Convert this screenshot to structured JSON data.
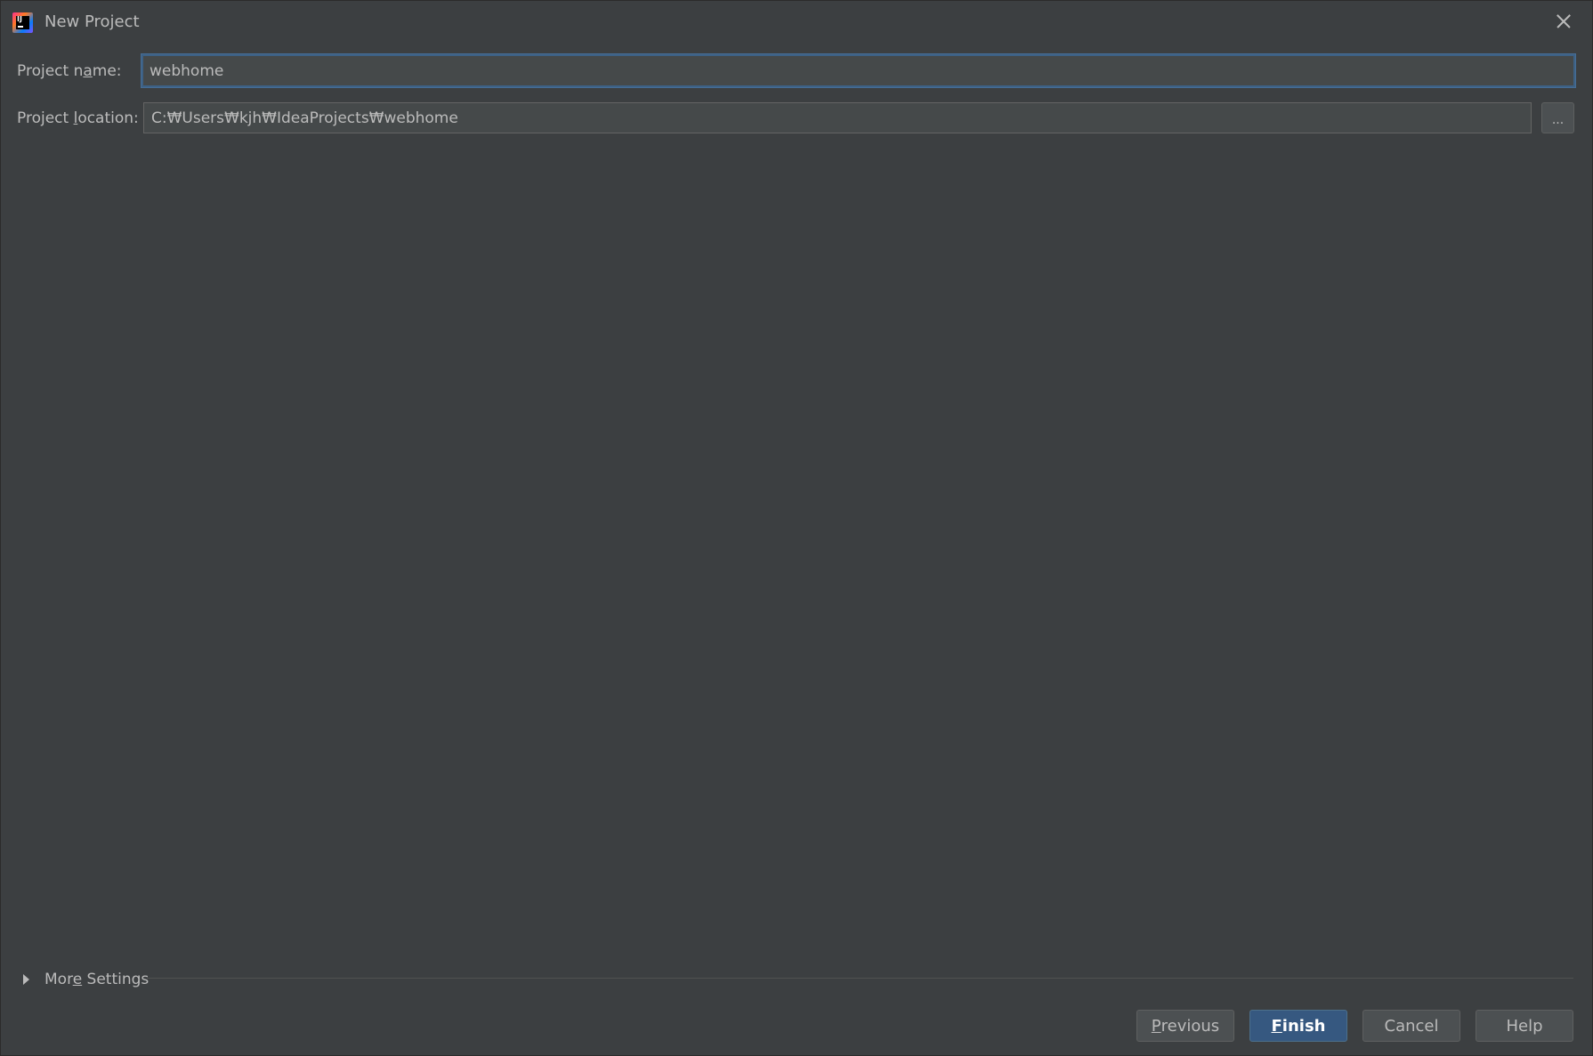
{
  "window": {
    "title": "New Project",
    "app_icon": "intellij-idea-icon",
    "close_icon": "close-icon"
  },
  "form": {
    "project_name": {
      "label_pre": "Project n",
      "label_mnemonic": "a",
      "label_post": "me:",
      "value": "webhome"
    },
    "project_location": {
      "label_pre": "Project ",
      "label_mnemonic": "l",
      "label_post": "ocation:",
      "value": "C:₩Users₩kjh₩IdeaProjects₩webhome",
      "browse_label": "..."
    }
  },
  "more_settings": {
    "label_pre": "Mor",
    "label_mnemonic": "e",
    "label_post": " Settings",
    "expanded": false
  },
  "buttons": {
    "previous": {
      "mnemonic": "P",
      "rest": "revious"
    },
    "finish": {
      "mnemonic": "F",
      "rest": "inish"
    },
    "cancel": {
      "label": "Cancel"
    },
    "help": {
      "label": "Help"
    }
  },
  "colors": {
    "background": "#3c3f41",
    "input_background": "#45494a",
    "focus_border": "#3d6185",
    "primary_button": "#365880",
    "text": "#bbbbbb"
  }
}
